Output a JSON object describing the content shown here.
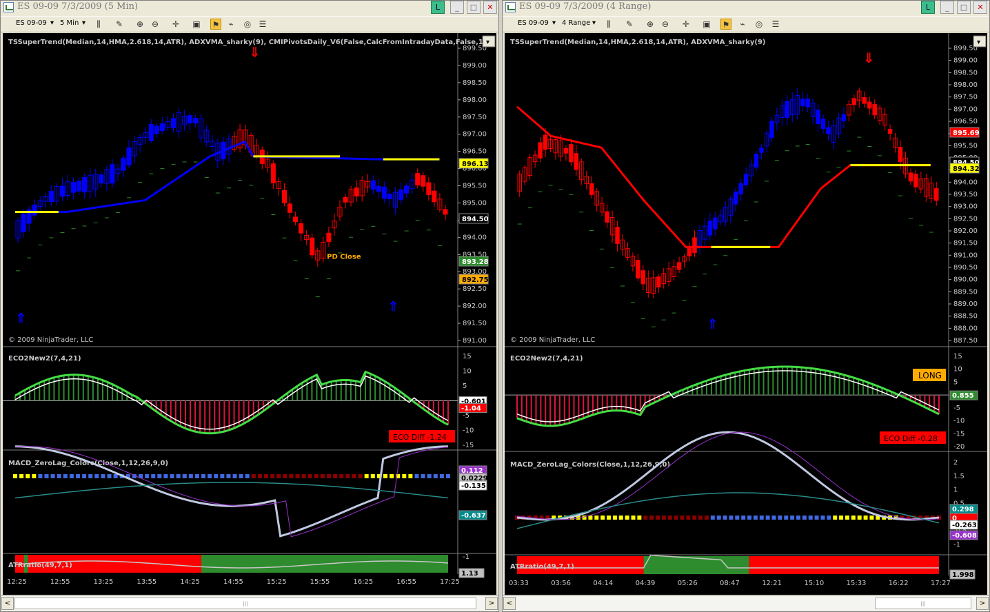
{
  "windows": [
    {
      "id": "left",
      "title": "ES 09-09  7/3/2009 (5 Min)",
      "toolbar": {
        "instrument": "ES 09-09",
        "period": "5 Min"
      },
      "price_panel": {
        "indicator_label": "TSSuperTrend(Median,14,HMA,2.618,14,ATR), ADXVMA_sharky(9), CMIPivotsDaily_V6(False,CalcFromIntradayData,False,15)",
        "copyright": "© 2009 NinjaTrader, LLC",
        "y_ticks": [
          "899.50",
          "899.00",
          "898.50",
          "898.00",
          "897.50",
          "897.00",
          "896.50",
          "896.00",
          "895.50",
          "895.00",
          "894.50",
          "894.00",
          "893.50",
          "893.00",
          "892.50",
          "892.00",
          "891.50",
          "891.00"
        ],
        "badges": [
          {
            "text": "896.13",
            "bg": "#ffff00",
            "fg": "#000000"
          },
          {
            "text": "894.50",
            "bg": "#000000",
            "fg": "#ffffff"
          },
          {
            "text": "893.28",
            "bg": "#2e8b2e",
            "fg": "#ffffff"
          },
          {
            "text": "892.75",
            "bg": "#ffaa00",
            "fg": "#000000"
          }
        ],
        "pivot_label": "PD Close"
      },
      "eco_panel": {
        "label": "ECO2New2(7,4,21)",
        "y_ticks": [
          "15",
          "10",
          "5",
          "0",
          "-5",
          "-10",
          "-15"
        ],
        "badges": [
          {
            "text": "-0.601",
            "bg": "#ffffff",
            "fg": "#000000"
          },
          {
            "text": "-1.04",
            "bg": "#ff0000",
            "fg": "#ffffff"
          }
        ],
        "diff_label": "ECO Diff -1.24"
      },
      "macd_panel": {
        "label": "MACD_ZeroLag_Colors(Close,1,12,26,9,0)",
        "y_ticks": [
          "0",
          "-0.5",
          "-1"
        ],
        "badges": [
          {
            "text": "0.112",
            "bg": "#9932cc",
            "fg": "#ffffff"
          },
          {
            "text": "0.0229",
            "bg": "#c0c0c0",
            "fg": "#000000"
          },
          {
            "text": "-0.135",
            "bg": "#ffffff",
            "fg": "#000000"
          },
          {
            "text": "-0.637",
            "bg": "#008b8b",
            "fg": "#ffffff"
          }
        ]
      },
      "atr_panel": {
        "label": "ATRratio(49,7,1)",
        "badge": {
          "text": "1.13",
          "bg": "#c0c0c0",
          "fg": "#000000"
        }
      },
      "x_ticks": [
        "12:25",
        "12:55",
        "13:25",
        "13:55",
        "14:25",
        "14:55",
        "15:25",
        "15:55",
        "16:25",
        "16:55",
        "17:25"
      ]
    },
    {
      "id": "right",
      "title": "ES 09-09  7/3/2009 (4 Range)",
      "toolbar": {
        "instrument": "ES 09-09",
        "period": "4 Range"
      },
      "price_panel": {
        "indicator_label": "TSSuperTrend(Median,14,HMA,2.618,14,ATR), ADXVMA_sharky(9)",
        "copyright": "© 2009 NinjaTrader, LLC",
        "y_ticks": [
          "899.50",
          "899.00",
          "898.50",
          "898.00",
          "897.50",
          "897.00",
          "896.50",
          "896.00",
          "895.50",
          "895.00",
          "894.50",
          "894.00",
          "893.50",
          "893.00",
          "892.50",
          "892.00",
          "891.50",
          "891.00",
          "890.50",
          "890.00",
          "889.50",
          "889.00",
          "888.50",
          "888.00",
          "887.50"
        ],
        "badges": [
          {
            "text": "895.69",
            "bg": "#ff0000",
            "fg": "#ffffff"
          },
          {
            "text": "894.50",
            "bg": "#000000",
            "fg": "#ffffff"
          },
          {
            "text": "894.32",
            "bg": "#ffff00",
            "fg": "#000000"
          }
        ],
        "pivot_label": ""
      },
      "eco_panel": {
        "label": "ECO2New2(7,4,21)",
        "y_ticks": [
          "15",
          "10",
          "5",
          "0",
          "-5",
          "-10",
          "-15",
          "-20"
        ],
        "badges": [
          {
            "text": "0.855",
            "bg": "#2e8b2e",
            "fg": "#ffffff"
          }
        ],
        "diff_label": "ECO Diff -0.28",
        "long_label": "LONG"
      },
      "macd_panel": {
        "label": "MACD_ZeroLag_Colors(Close,1,12,26,9,0)",
        "y_ticks": [
          "2",
          "1.5",
          "1",
          "0.5",
          "0",
          "-0.5",
          "-1"
        ],
        "badges": [
          {
            "text": "0.298",
            "bg": "#008b8b",
            "fg": "#ffffff"
          },
          {
            "text": "0",
            "bg": "#ff0000",
            "fg": "#ffffff"
          },
          {
            "text": "-0.263",
            "bg": "#ffffff",
            "fg": "#000000"
          },
          {
            "text": "-0.608",
            "bg": "#9932cc",
            "fg": "#ffffff"
          }
        ]
      },
      "atr_panel": {
        "label": "ATRratio(49,7,1)",
        "badge": {
          "text": "1.998",
          "bg": "#c0c0c0",
          "fg": "#000000"
        }
      },
      "x_ticks": [
        "03:33",
        "03:56",
        "04:14",
        "04:39",
        "05:26",
        "08:47",
        "12:21",
        "15:10",
        "15:33",
        "16:22",
        "17:27"
      ]
    }
  ],
  "window_buttons": {
    "link": "L",
    "minimize": "_",
    "maximize": "□",
    "close": "✕"
  },
  "scrollbar": {
    "left": "<",
    "right": ">"
  },
  "colors": {
    "up_bar": "#0000ff",
    "down_bar": "#ff0000",
    "supertrend_up": "#0000ff",
    "supertrend_down": "#ff0000",
    "flat": "#ffff00",
    "eco_pos": "#2e8b2e",
    "eco_neg": "#dc143c"
  }
}
